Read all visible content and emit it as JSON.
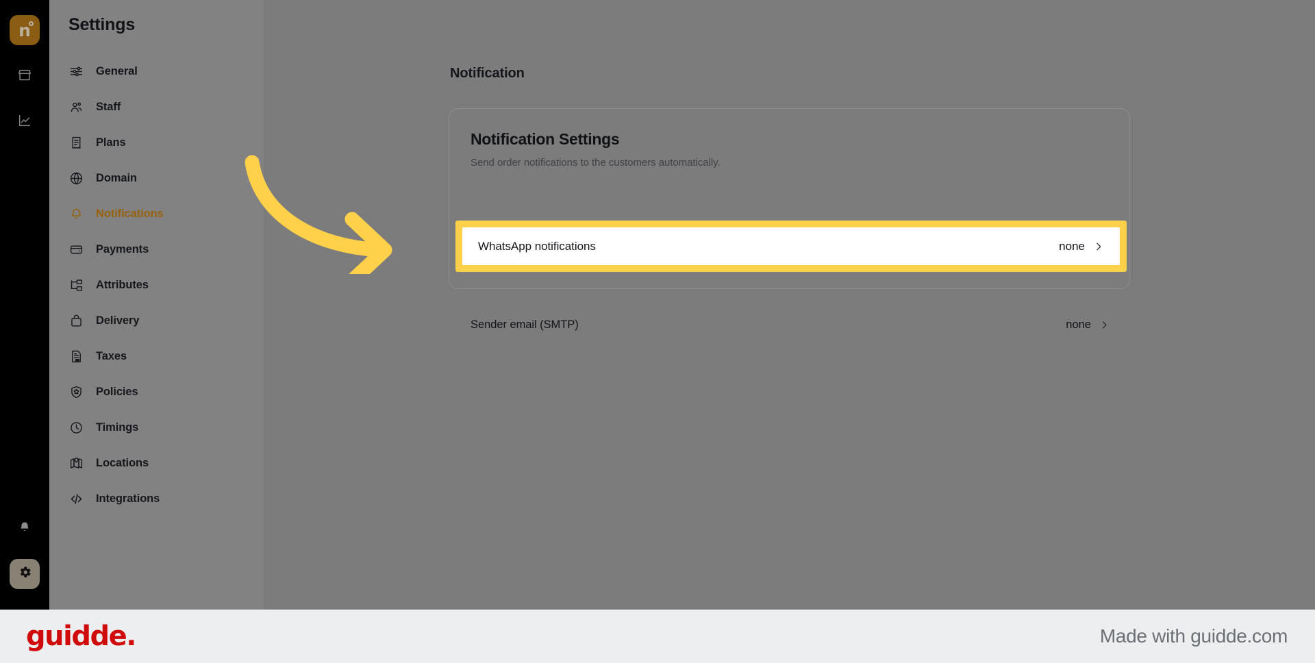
{
  "rail": {
    "logo_mark": "n",
    "items": [
      {
        "name": "store-icon",
        "label": "Store"
      },
      {
        "name": "analytics-icon",
        "label": "Analytics"
      }
    ],
    "bottom": [
      {
        "name": "bell-icon",
        "label": "Notifications"
      },
      {
        "name": "gear-icon",
        "label": "Settings"
      }
    ]
  },
  "sidebar": {
    "title": "Settings",
    "items": [
      {
        "label": "General",
        "icon": "sliders-icon",
        "active": false
      },
      {
        "label": "Staff",
        "icon": "users-icon",
        "active": false
      },
      {
        "label": "Plans",
        "icon": "receipt-icon",
        "active": false
      },
      {
        "label": "Domain",
        "icon": "globe-icon",
        "active": false
      },
      {
        "label": "Notifications",
        "icon": "bell-icon",
        "active": true
      },
      {
        "label": "Payments",
        "icon": "wallet-icon",
        "active": false
      },
      {
        "label": "Attributes",
        "icon": "hierarchy-icon",
        "active": false
      },
      {
        "label": "Delivery",
        "icon": "bag-icon",
        "active": false
      },
      {
        "label": "Taxes",
        "icon": "tax-document-icon",
        "active": false
      },
      {
        "label": "Policies",
        "icon": "shield-icon",
        "active": false
      },
      {
        "label": "Timings",
        "icon": "clock-icon",
        "active": false
      },
      {
        "label": "Locations",
        "icon": "map-icon",
        "active": false
      },
      {
        "label": "Integrations",
        "icon": "code-icon",
        "active": false
      }
    ]
  },
  "main": {
    "page_title": "Notification",
    "card": {
      "title": "Notification Settings",
      "subtitle": "Send order notifications to the customers automatically.",
      "rows": [
        {
          "label": "Sender email (SMTP)",
          "value": "none",
          "highlighted": false
        },
        {
          "label": "WhatsApp notifications",
          "value": "none",
          "highlighted": true
        }
      ]
    }
  },
  "annotation": {
    "arrow_color": "#FFD04A",
    "highlight_color": "#FFD04A",
    "accent_color": "#96620E"
  },
  "footer": {
    "brand": "guidde.",
    "made_with": "Made with guidde.com"
  }
}
